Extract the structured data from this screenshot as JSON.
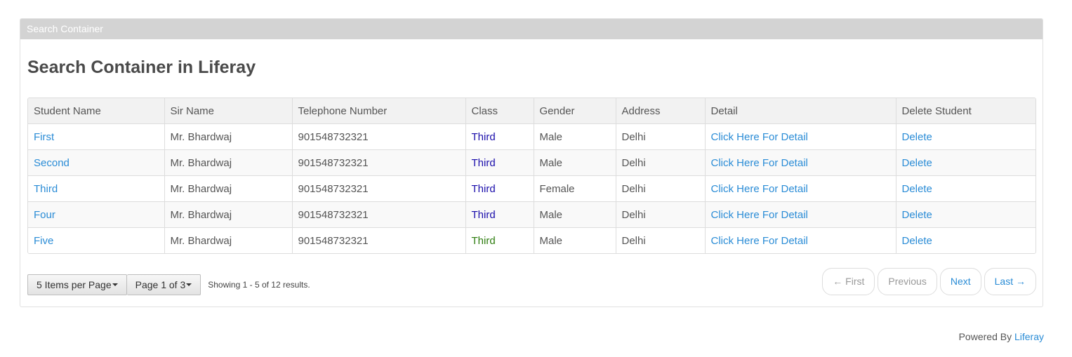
{
  "portlet": {
    "header": "Search Container",
    "title": "Search Container in Liferay"
  },
  "table": {
    "columns": [
      "Student Name",
      "Sir Name",
      "Telephone Number",
      "Class",
      "Gender",
      "Address",
      "Detail",
      "Delete Student"
    ],
    "rows": [
      {
        "name": "First",
        "sirname": "Mr. Bhardwaj",
        "phone": "901548732321",
        "class": "Third",
        "gender": "Male",
        "address": "Delhi",
        "detail": "Click Here For Detail",
        "delete": "Delete"
      },
      {
        "name": "Second",
        "sirname": "Mr. Bhardwaj",
        "phone": "901548732321",
        "class": "Third",
        "gender": "Male",
        "address": "Delhi",
        "detail": "Click Here For Detail",
        "delete": "Delete"
      },
      {
        "name": "Third",
        "sirname": "Mr. Bhardwaj",
        "phone": "901548732321",
        "class": "Third",
        "gender": "Female",
        "address": "Delhi",
        "detail": "Click Here For Detail",
        "delete": "Delete"
      },
      {
        "name": "Four",
        "sirname": "Mr. Bhardwaj",
        "phone": "901548732321",
        "class": "Third",
        "gender": "Male",
        "address": "Delhi",
        "detail": "Click Here For Detail",
        "delete": "Delete"
      },
      {
        "name": "Five",
        "sirname": "Mr. Bhardwaj",
        "phone": "901548732321",
        "class": "Third",
        "gender": "Male",
        "address": "Delhi",
        "detail": "Click Here For Detail",
        "delete": "Delete"
      }
    ],
    "class_colors": [
      "#1a0dab",
      "#1a0dab",
      "#1a0dab",
      "#1a0dab",
      "#2e7d0f"
    ]
  },
  "pagination": {
    "items_per_page": "5 Items per Page",
    "page_of": "Page 1 of 3",
    "results": "Showing 1 - 5 of 12 results.",
    "first": "← First",
    "previous": "Previous",
    "next": "Next",
    "last": "Last →"
  },
  "footer": {
    "powered_by": "Powered By",
    "brand": "Liferay"
  },
  "colors": {
    "link": "#2a8cd6",
    "header_bar": "#d3d3d3"
  }
}
